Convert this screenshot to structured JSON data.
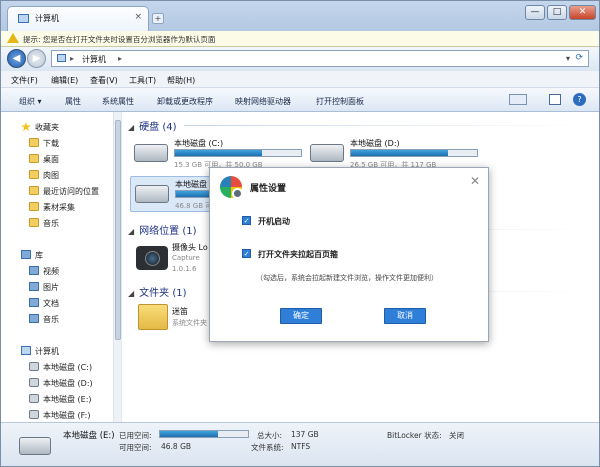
{
  "window": {
    "tab_title": "计算机",
    "tab_close": "×",
    "new_tab": "+",
    "min": "—",
    "max": "□",
    "close": "✕"
  },
  "notification": {
    "text": "提示: 您是否在打开文件夹时设置百分浏览器作为默认页面"
  },
  "address": {
    "back": "◀",
    "forward": "▶",
    "sep1": "▸",
    "path": "计算机",
    "sep2": "▸",
    "dropdown": "▾",
    "refresh": "⟳"
  },
  "menu": [
    "文件(F)",
    "编辑(E)",
    "查看(V)",
    "工具(T)",
    "帮助(H)"
  ],
  "commands": [
    "组织 ▾",
    "属性",
    "系统属性",
    "卸载或更改程序",
    "映射网络驱动器",
    "打开控制面板"
  ],
  "help_icon": "?",
  "nav": {
    "favorites": "收藏夹",
    "fav_items": [
      "下载",
      "桌面",
      "肉图",
      "最近访问的位置",
      "素材采集",
      "音乐"
    ],
    "library": "库",
    "lib_items": [
      "视频",
      "图片",
      "文档",
      "音乐"
    ],
    "computer": "计算机",
    "comp_items": [
      "本地磁盘 (C:)",
      "本地磁盘 (D:)",
      "本地磁盘 (E:)",
      "本地磁盘 (F:)"
    ]
  },
  "content": {
    "group_drives": "硬盘 (4)",
    "group_network": "网络位置 (1)",
    "group_folders": "文件夹 (1)",
    "group_arrow": "◢",
    "drive_c": {
      "name": "本地磁盘 (C:)",
      "sub": "15.3 GB 可用，共 50.0 GB",
      "used": 0.69
    },
    "drive_d": {
      "name": "本地磁盘 (D:)",
      "sub": "26.5 GB 可用，共 117 GB",
      "used": 0.77
    },
    "drive_e": {
      "name": "本地磁盘 (E:)",
      "sub": "46.8 GB 可用",
      "used": 0.66
    },
    "network_item": {
      "name": "摄像头 Lo",
      "sub1": "Capture",
      "sub2": "1.0.1.6"
    },
    "folder_item": {
      "name": "迷笛",
      "sub": "系统文件夹"
    }
  },
  "status": {
    "drive_name": "本地磁盘 (E:)",
    "used_label": "已用空间:",
    "free_label": "可用空间:",
    "free_value": "46.8 GB",
    "total_label": "总大小:",
    "total_value": "137 GB",
    "fs_label": "文件系统:",
    "fs_value": "NTFS",
    "bitlocker_label": "BitLocker 状态:",
    "bitlocker_value": "关闭",
    "used_fraction": 0.66
  },
  "dialog": {
    "title": "属性设置",
    "close": "✕",
    "check_mark": "✓",
    "opt1": "开机启动",
    "opt2": "打开文件夹拉起百页箍",
    "note": "（勾选后，系统会拉起新建文件浏览，操作文件更加便利）",
    "ok": "确定",
    "cancel": "取消"
  }
}
